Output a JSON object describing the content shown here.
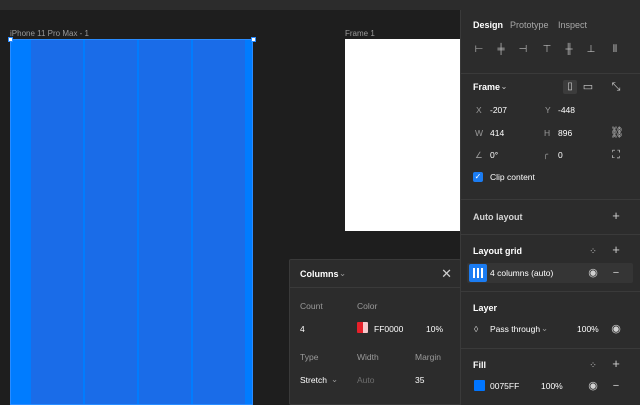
{
  "canvas": {
    "frames": [
      {
        "label": "iPhone 11 Pro Max - 1"
      },
      {
        "label": "Frame 1"
      }
    ]
  },
  "panel": {
    "tabs": [
      "Design",
      "Prototype",
      "Inspect"
    ],
    "frame": {
      "title": "Frame",
      "x_label": "X",
      "x_value": "-207",
      "y_label": "Y",
      "y_value": "-448",
      "w_label": "W",
      "w_value": "414",
      "h_label": "H",
      "h_value": "896",
      "rotation": "0°",
      "radius": "0",
      "clip_content": "Clip content"
    },
    "auto_layout": {
      "title": "Auto layout"
    },
    "layout_grid": {
      "title": "Layout grid",
      "item": "4 columns (auto)"
    },
    "layer": {
      "title": "Layer",
      "blend": "Pass through",
      "opacity": "100%"
    },
    "fill": {
      "title": "Fill",
      "hex": "0075FF",
      "opacity": "100%",
      "color": "#0075FF"
    }
  },
  "popover": {
    "title": "Columns",
    "count_label": "Count",
    "count_value": "4",
    "color_label": "Color",
    "color_hex": "FF0000",
    "color_opacity": "10%",
    "color": "#FF0000",
    "type_label": "Type",
    "type_value": "Stretch",
    "width_label": "Width",
    "width_value": "Auto",
    "margin_label": "Margin",
    "margin_value": "35"
  },
  "colors": {
    "accent": "#1B7CF2",
    "frame_fill": "#007CFF",
    "panel_bg": "#2C2C2C",
    "canvas_bg": "#1E1E1E"
  }
}
